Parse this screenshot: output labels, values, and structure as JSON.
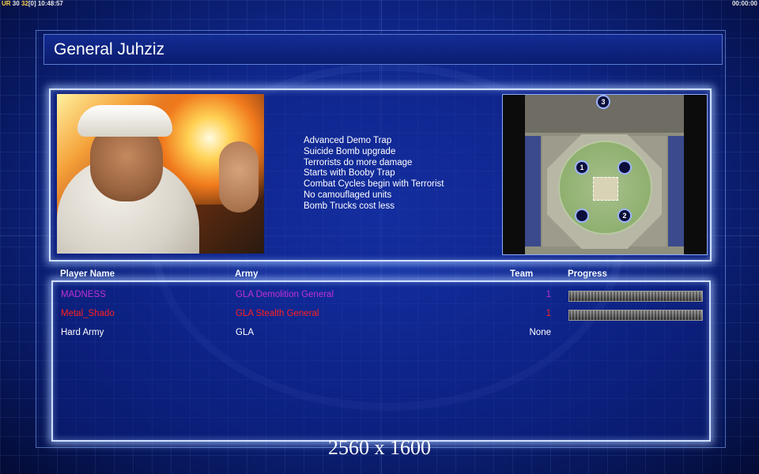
{
  "status_bar": {
    "left_prefix": "UR",
    "left_a": "30",
    "left_b": "32",
    "left_c": "[0]",
    "clock": "10:48:57",
    "right_timer": "00:00:00"
  },
  "general": {
    "title": "General Juhziz",
    "traits": [
      "Advanced Demo Trap",
      "Suicide Bomb upgrade",
      "Terrorists do more damage",
      "Starts with Booby Trap",
      "Combat Cycles begin with Terrorist",
      "No camouflaged units",
      "Bomb Trucks cost less"
    ]
  },
  "minimap": {
    "markers": [
      "1",
      "2",
      "3"
    ]
  },
  "table": {
    "headers": {
      "player_name": "Player Name",
      "army": "Army",
      "team": "Team",
      "progress": "Progress"
    },
    "rows": [
      {
        "name": "MADNESS",
        "army": "GLA Demolition General",
        "team": "1",
        "color": "#c030d8",
        "progress": 1.0
      },
      {
        "name": "Metal_Shado",
        "army": "GLA Stealth General",
        "team": "1",
        "color": "#ff2020",
        "progress": 1.0
      },
      {
        "name": "Hard Army",
        "army": "GLA",
        "team": "None",
        "color": "#ffffff"
      }
    ]
  },
  "resolution_label": "2560 x 1600"
}
